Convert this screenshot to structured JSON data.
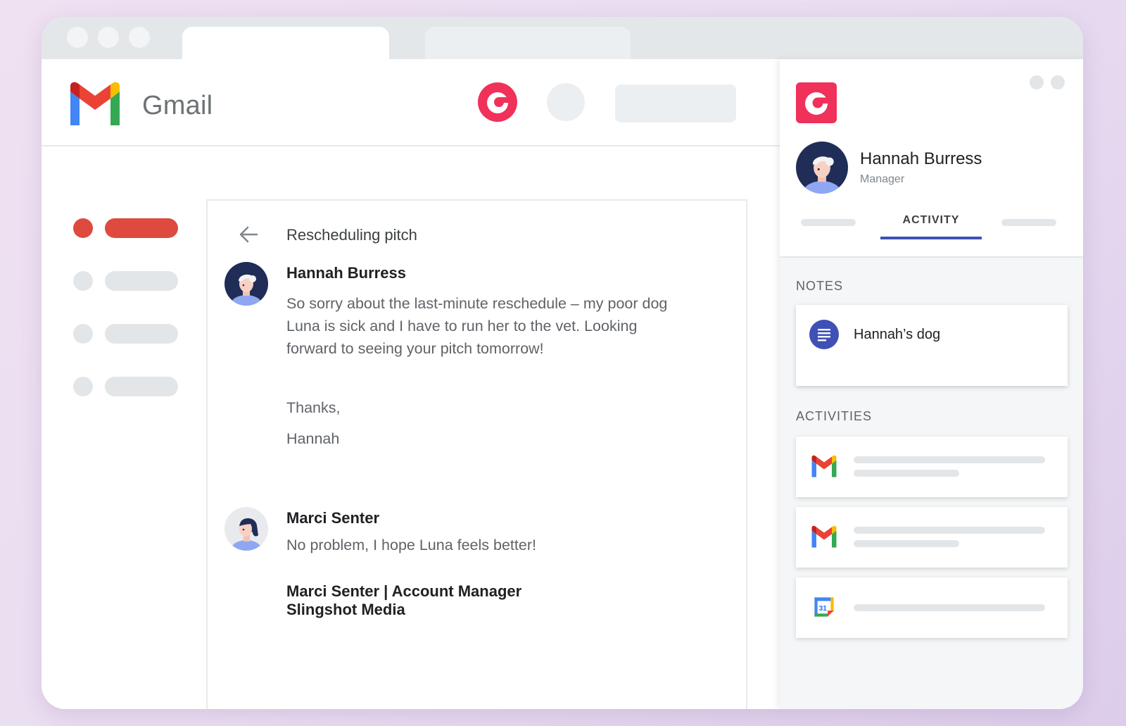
{
  "app": {
    "name": "Gmail"
  },
  "email": {
    "subject": "Rescheduling pitch",
    "messages": [
      {
        "sender": "Hannah Burress",
        "body_lines": [
          "So sorry about the last-minute reschedule – my poor dog",
          "Luna is sick and I have to run her to the vet. Looking",
          "forward to seeing your pitch tomorrow!"
        ],
        "closing": "Thanks,",
        "signoff": "Hannah"
      },
      {
        "sender": "Marci Senter",
        "body": "No problem, I hope Luna feels better!",
        "signature_line1": "Marci Senter | Account Manager",
        "signature_line2": "Slingshot Media"
      }
    ]
  },
  "panel": {
    "contact_name": "Hannah Burress",
    "contact_role": "Manager",
    "active_tab": "ACTIVITY",
    "notes_label": "NOTES",
    "note_title": "Hannah’s dog",
    "activities_label": "ACTIVITIES",
    "activities": [
      {
        "icon": "gmail-icon"
      },
      {
        "icon": "gmail-icon"
      },
      {
        "icon": "calendar-icon",
        "day": "31"
      }
    ]
  },
  "colors": {
    "copper_brand": "#f0315a",
    "gmail_red": "#de4a3e",
    "tab_accent": "#3f51b5"
  }
}
